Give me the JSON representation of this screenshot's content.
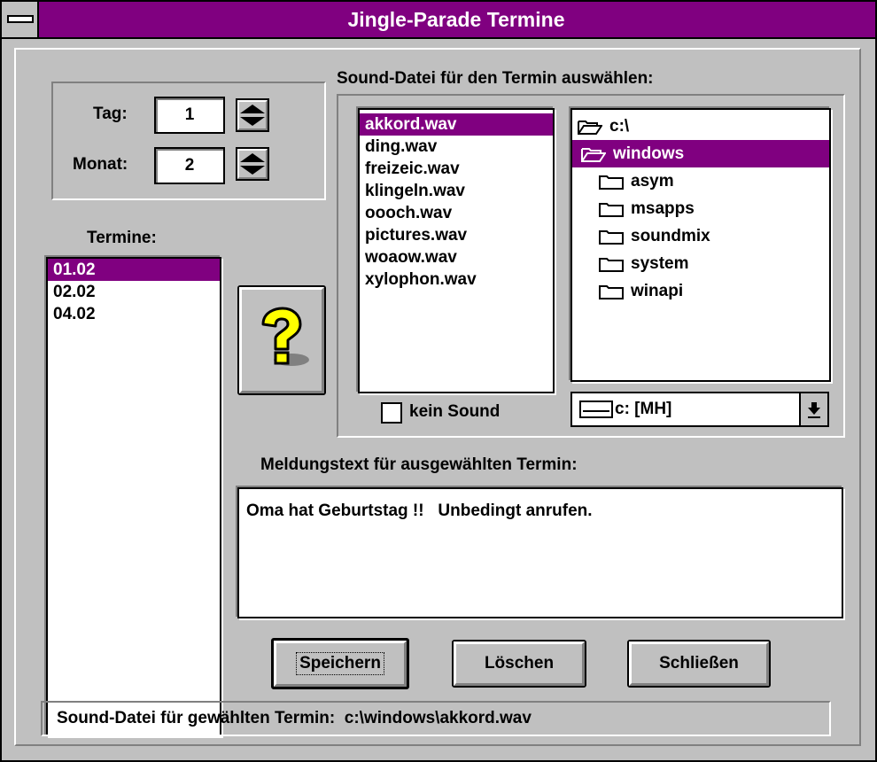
{
  "window": {
    "title": "Jingle-Parade Termine"
  },
  "date": {
    "day_label": "Tag:",
    "day_value": "1",
    "month_label": "Monat:",
    "month_value": "2"
  },
  "appointments": {
    "label": "Termine:",
    "items": [
      "01.02",
      "02.02",
      "04.02"
    ],
    "selected_index": 0
  },
  "sound": {
    "group_label": "Sound-Datei für den Termin auswählen:",
    "files": [
      "akkord.wav",
      "ding.wav",
      "freizeic.wav",
      "klingeln.wav",
      "oooch.wav",
      "pictures.wav",
      "woaow.wav",
      "xylophon.wav"
    ],
    "selected_file_index": 0,
    "directories": [
      {
        "name": "c:\\",
        "level": 0,
        "open": true
      },
      {
        "name": "windows",
        "level": 1,
        "open": true,
        "selected": true
      },
      {
        "name": "asym",
        "level": 2
      },
      {
        "name": "msapps",
        "level": 2
      },
      {
        "name": "soundmix",
        "level": 2
      },
      {
        "name": "system",
        "level": 2
      },
      {
        "name": "winapi",
        "level": 2
      }
    ],
    "drive": "c: [MH]",
    "no_sound_label": "kein Sound",
    "no_sound_checked": false
  },
  "message": {
    "label": "Meldungstext für ausgewählten Termin:",
    "text": "Oma hat Geburtstag !!   Unbedingt anrufen."
  },
  "buttons": {
    "save": "Speichern",
    "delete": "Löschen",
    "close": "Schließen"
  },
  "status": {
    "text": "Sound-Datei für gewählten Termin:  c:\\windows\\akkord.wav"
  },
  "colors": {
    "accent": "#800080",
    "face": "#c0c0c0",
    "help_icon": "#ffff00"
  },
  "icons": {
    "sysmenu": "system-menu-icon",
    "help": "question-mark-icon",
    "spin": "up-down-arrows-icon",
    "folder": "folder-icon",
    "drive": "drive-icon",
    "dropdown": "dropdown-arrow-icon"
  }
}
